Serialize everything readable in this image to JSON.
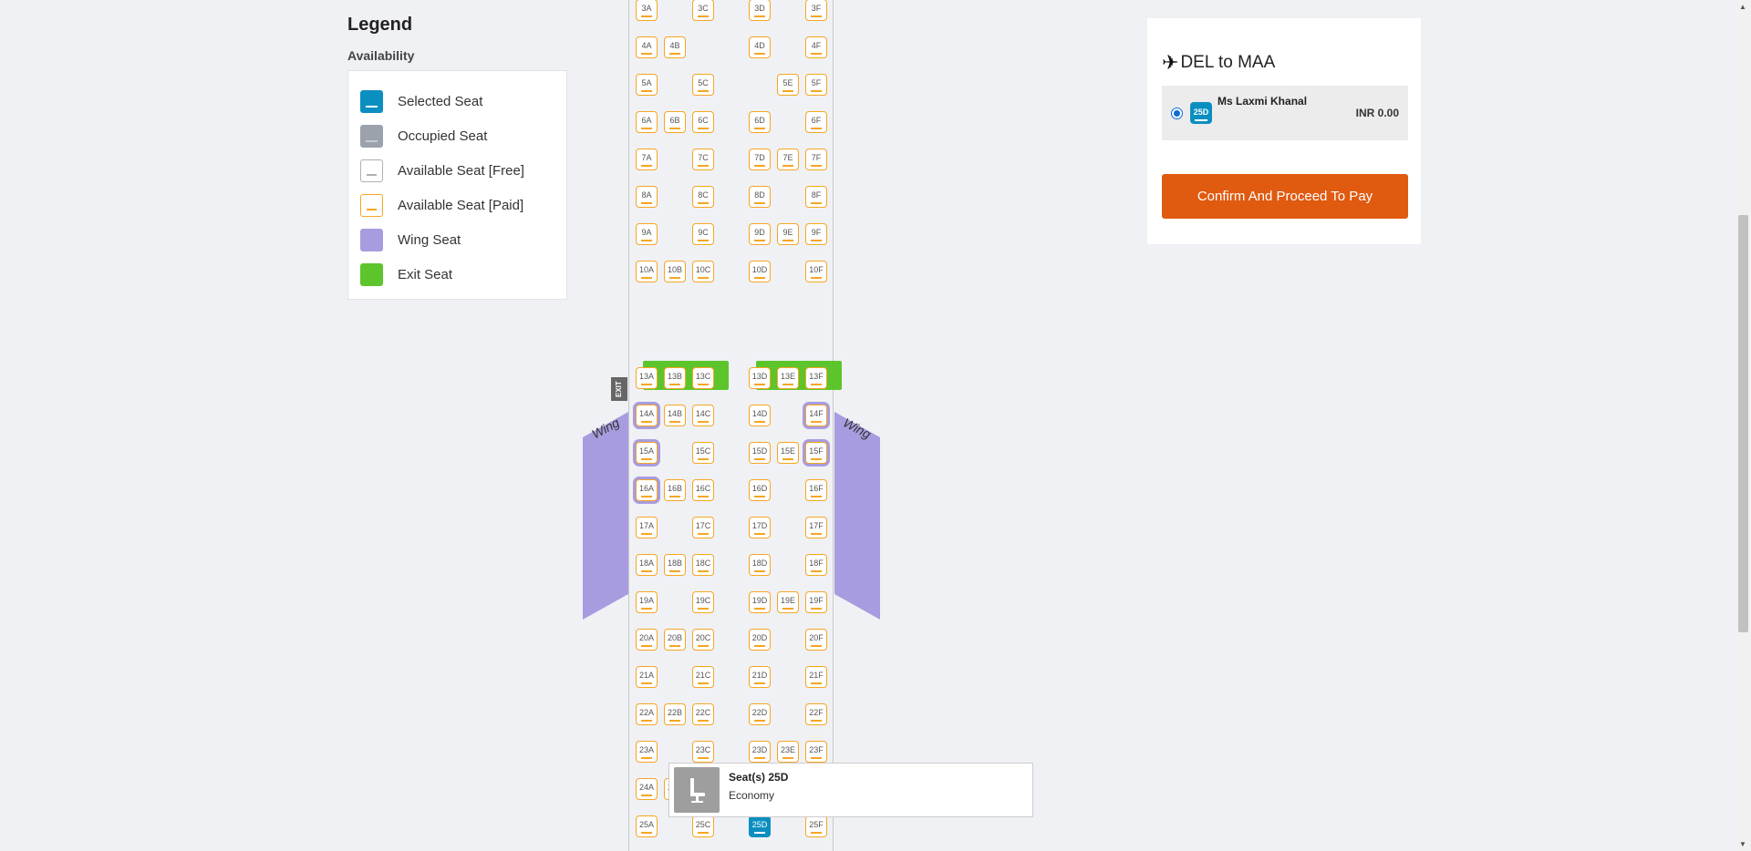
{
  "legend": {
    "title": "Legend",
    "subtitle": "Availability",
    "items": [
      {
        "label": "Selected Seat",
        "color": "#0b8fc1",
        "bar": "#ffffff",
        "icon": "seat-selected-icon"
      },
      {
        "label": "Occupied Seat",
        "color": "#9ba2ab",
        "bar": "#c7ccd2",
        "icon": "seat-occupied-icon"
      },
      {
        "label": "Available Seat [Free]",
        "color": "#ffffff",
        "bar": "#b0b0b0",
        "icon": "seat-free-icon",
        "border": "#b0b0b0"
      },
      {
        "label": "Available Seat [Paid]",
        "color": "#ffffff",
        "bar": "#f5a623",
        "icon": "seat-paid-icon",
        "border": "#f5a623"
      },
      {
        "label": "Wing Seat",
        "color": "#a89ce0",
        "icon": "wing-seat-icon"
      },
      {
        "label": "Exit Seat",
        "color": "#5cc52b",
        "icon": "exit-seat-icon"
      }
    ]
  },
  "seat_map": {
    "exit_label": "EXIT",
    "wing_label": "Wing",
    "rows": [
      {
        "row": "3",
        "seats": [
          "3A",
          "3C",
          "3D",
          "3F"
        ]
      },
      {
        "row": "4",
        "seats": [
          "4A",
          "4B",
          "4D",
          "4F"
        ]
      },
      {
        "row": "5",
        "seats": [
          "5A",
          "5C",
          "5E",
          "5F"
        ]
      },
      {
        "row": "6",
        "seats": [
          "6A",
          "6B",
          "6C",
          "6D",
          "6F"
        ]
      },
      {
        "row": "7",
        "seats": [
          "7A",
          "7C",
          "7D",
          "7E",
          "7F"
        ]
      },
      {
        "row": "8",
        "seats": [
          "8A",
          "8C",
          "8D",
          "8F"
        ]
      },
      {
        "row": "9",
        "seats": [
          "9A",
          "9C",
          "9D",
          "9E",
          "9F"
        ]
      },
      {
        "row": "10",
        "seats": [
          "10A",
          "10B",
          "10C",
          "10D",
          "10F"
        ]
      },
      {
        "row": "13",
        "seats": [
          "13A",
          "13B",
          "13C",
          "13D",
          "13E",
          "13F"
        ],
        "exit": true
      },
      {
        "row": "14",
        "seats": [
          "14A",
          "14B",
          "14C",
          "14D",
          "14F"
        ]
      },
      {
        "row": "15",
        "seats": [
          "15A",
          "15C",
          "15D",
          "15E",
          "15F"
        ]
      },
      {
        "row": "16",
        "seats": [
          "16A",
          "16B",
          "16C",
          "16D",
          "16F"
        ]
      },
      {
        "row": "17",
        "seats": [
          "17A",
          "17C",
          "17D",
          "17F"
        ]
      },
      {
        "row": "18",
        "seats": [
          "18A",
          "18B",
          "18C",
          "18D",
          "18F"
        ]
      },
      {
        "row": "19",
        "seats": [
          "19A",
          "19C",
          "19D",
          "19E",
          "19F"
        ]
      },
      {
        "row": "20",
        "seats": [
          "20A",
          "20B",
          "20C",
          "20D",
          "20F"
        ]
      },
      {
        "row": "21",
        "seats": [
          "21A",
          "21C",
          "21D",
          "21F"
        ]
      },
      {
        "row": "22",
        "seats": [
          "22A",
          "22B",
          "22C",
          "22D",
          "22F"
        ]
      },
      {
        "row": "23",
        "seats": [
          "23A",
          "23C",
          "23D",
          "23E",
          "23F"
        ]
      },
      {
        "row": "24",
        "seats": [
          "24A",
          "24B"
        ]
      },
      {
        "row": "25",
        "seats": [
          "25A",
          "25C",
          "25D",
          "25F"
        ]
      }
    ],
    "wing_seats": [
      "14A",
      "15A",
      "16A",
      "14F",
      "15F"
    ],
    "selected_seats": [
      "25D"
    ]
  },
  "tooltip": {
    "title": "Seat(s) 25D",
    "cabin_class": "Economy",
    "icon": "seat-chair-icon"
  },
  "booking": {
    "route": "DEL to MAA",
    "route_icon": "airplane-icon",
    "passenger": {
      "seat": "25D",
      "name": "Ms Laxmi Khanal",
      "price": "INR 0.00"
    },
    "confirm_label": "Confirm And Proceed To Pay"
  },
  "colors": {
    "selected": "#0b8fc1",
    "paid": "#f5a623",
    "wing": "#a89ce0",
    "exit": "#5cc52b",
    "confirm": "#e05a10"
  }
}
